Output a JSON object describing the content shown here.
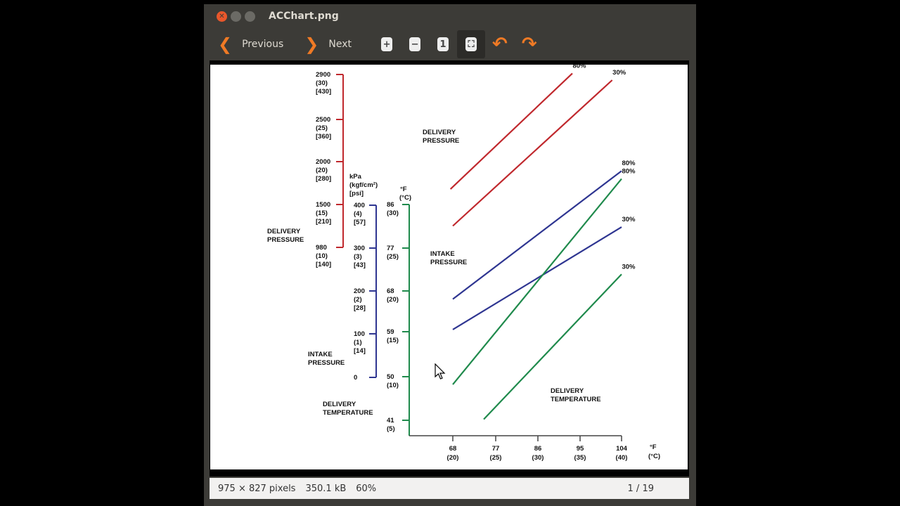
{
  "window": {
    "title": "ACChart.png"
  },
  "toolbar": {
    "previous_label": "Previous",
    "next_label": "Next",
    "icons": [
      "zoom-in-icon",
      "zoom-out-icon",
      "normal-size-icon",
      "best-fit-icon",
      "rotate-left-icon",
      "rotate-right-icon"
    ],
    "accent": "#f07a25"
  },
  "status": {
    "dimensions": "975 × 827 pixels",
    "size": "350.1 kB",
    "zoom": "60%",
    "page": "1 / 19"
  },
  "chart_data": {
    "type": "line",
    "xlabel": "°F (°C)",
    "x_ticks": [
      "68",
      "77",
      "86",
      "95",
      "104"
    ],
    "x_ticks_c": [
      "(20)",
      "(25)",
      "(30)",
      "(35)",
      "(40)"
    ],
    "x_unit": "°F",
    "x_unit_c": "(°C)",
    "axes": [
      {
        "label": "DELIVERY PRESSURE",
        "color": "#c0282d",
        "ticks": [
          {
            "v": "2900",
            "a": "(30)",
            "b": "[430]"
          },
          {
            "v": "2500",
            "a": "(25)",
            "b": "[360]"
          },
          {
            "v": "2000",
            "a": "(20)",
            "b": "[280]"
          },
          {
            "v": "1500",
            "a": "(15)",
            "b": "[210]"
          },
          {
            "v": "980",
            "a": "(10)",
            "b": "[140]"
          }
        ]
      },
      {
        "label": "INTAKE PRESSURE",
        "unit": "kPa",
        "unit2": "(kgf/cm²)",
        "unit3": "[psi]",
        "color": "#2e3591",
        "ticks": [
          {
            "v": "400",
            "a": "(4)",
            "b": "[57]"
          },
          {
            "v": "300",
            "a": "(3)",
            "b": "[43]"
          },
          {
            "v": "200",
            "a": "(2)",
            "b": "[28]"
          },
          {
            "v": "100",
            "a": "(1)",
            "b": "[14]"
          },
          {
            "v": "0",
            "a": "",
            "b": ""
          }
        ]
      },
      {
        "label": "DELIVERY TEMPERATURE",
        "unit": "°F",
        "unit2": "(°C)",
        "color": "#1f8a4c",
        "ticks": [
          {
            "v": "86",
            "a": "(30)"
          },
          {
            "v": "77",
            "a": "(25)"
          },
          {
            "v": "68",
            "a": "(20)"
          },
          {
            "v": "59",
            "a": "(15)"
          },
          {
            "v": "50",
            "a": "(10)"
          },
          {
            "v": "41",
            "a": "(5)"
          }
        ]
      }
    ],
    "series": [
      {
        "name": "80%",
        "group": "DELIVERY PRESSURE",
        "axis": 0,
        "x": [
          67.5,
          93.5
        ],
        "y": [
          1680,
          2910
        ]
      },
      {
        "name": "30%",
        "group": "DELIVERY PRESSURE",
        "axis": 0,
        "x": [
          68,
          102
        ],
        "y": [
          1240,
          2850
        ]
      },
      {
        "name": "80%",
        "group": "INTAKE PRESSURE",
        "axis": 1,
        "x": [
          68,
          104
        ],
        "y": [
          181,
          480
        ]
      },
      {
        "name": "30%",
        "group": "INTAKE PRESSURE",
        "axis": 1,
        "x": [
          68,
          104
        ],
        "y": [
          110,
          349
        ]
      },
      {
        "name": "80%",
        "group": "DELIVERY TEMPERATURE",
        "axis": 2,
        "x": [
          68,
          104
        ],
        "y": [
          48.4,
          91.3
        ]
      },
      {
        "name": "30%",
        "group": "DELIVERY TEMPERATURE",
        "axis": 2,
        "x": [
          74.6,
          104
        ],
        "y": [
          41.2,
          71.5
        ]
      }
    ],
    "group_labels": [
      "DELIVERY PRESSURE",
      "INTAKE PRESSURE",
      "DELIVERY TEMPERATURE"
    ]
  }
}
